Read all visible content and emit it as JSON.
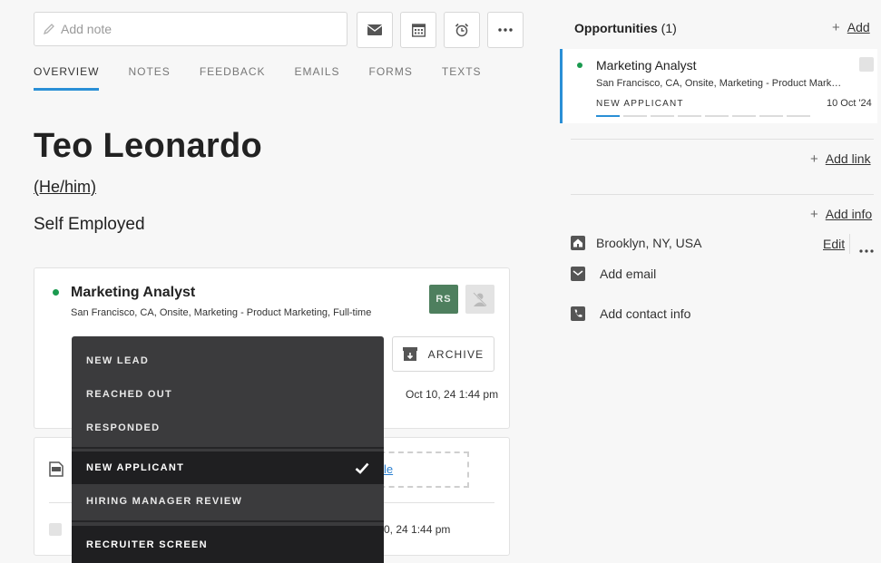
{
  "note": {
    "placeholder": "Add note"
  },
  "toolbar": {
    "email_icon": "envelope-icon",
    "calendar_icon": "calendar-icon",
    "alarm_icon": "alarm-clock-icon",
    "more_icon": "ellipsis-icon"
  },
  "tabs": [
    {
      "label": "OVERVIEW"
    },
    {
      "label": "NOTES"
    },
    {
      "label": "FEEDBACK"
    },
    {
      "label": "EMAILS"
    },
    {
      "label": "FORMS"
    },
    {
      "label": "TEXTS"
    }
  ],
  "profile": {
    "name": "Teo Leonardo",
    "pronouns": "(He/him)",
    "headline": "Self Employed"
  },
  "opportunity_card": {
    "title": "Marketing Analyst",
    "details": "San Francisco, CA, Onsite, Marketing - Product Marketing, Full-time",
    "owner_initials": "RS",
    "archive_label": "ARCHIVE",
    "timestamp": "Oct 10, 24 1:44 pm"
  },
  "stage_dropdown": {
    "items": [
      {
        "label": "NEW LEAD"
      },
      {
        "label": "REACHED OUT"
      },
      {
        "label": "RESPONDED"
      },
      {
        "label": "NEW APPLICANT",
        "selected": true
      },
      {
        "label": "HIRING MANAGER REVIEW"
      },
      {
        "label": "RECRUITER SCREEN"
      }
    ]
  },
  "files_card": {
    "link_fragment": "le",
    "timestamp_fragment": "0, 24 1:44 pm"
  },
  "sidebar": {
    "opportunities_title": "Opportunities",
    "opportunities_count": "(1)",
    "add_label": "Add",
    "opportunity": {
      "title": "Marketing Analyst",
      "details": "San Francisco, CA, Onsite, Marketing - Product Mark…",
      "stage": "NEW APPLICANT",
      "date": "10 Oct '24",
      "progress_active": 1,
      "progress_total": 8
    },
    "add_link_label": "Add link",
    "add_info_label": "Add info",
    "location": "Brooklyn, NY, USA",
    "edit_label": "Edit",
    "add_email_label": "Add email",
    "add_contact_label": "Add contact info"
  },
  "colors": {
    "accent": "#2a8fd6",
    "status_green": "#1a9a4f",
    "owner_badge": "#4e7f5e",
    "dropdown_bg": "#3b3b3d"
  }
}
